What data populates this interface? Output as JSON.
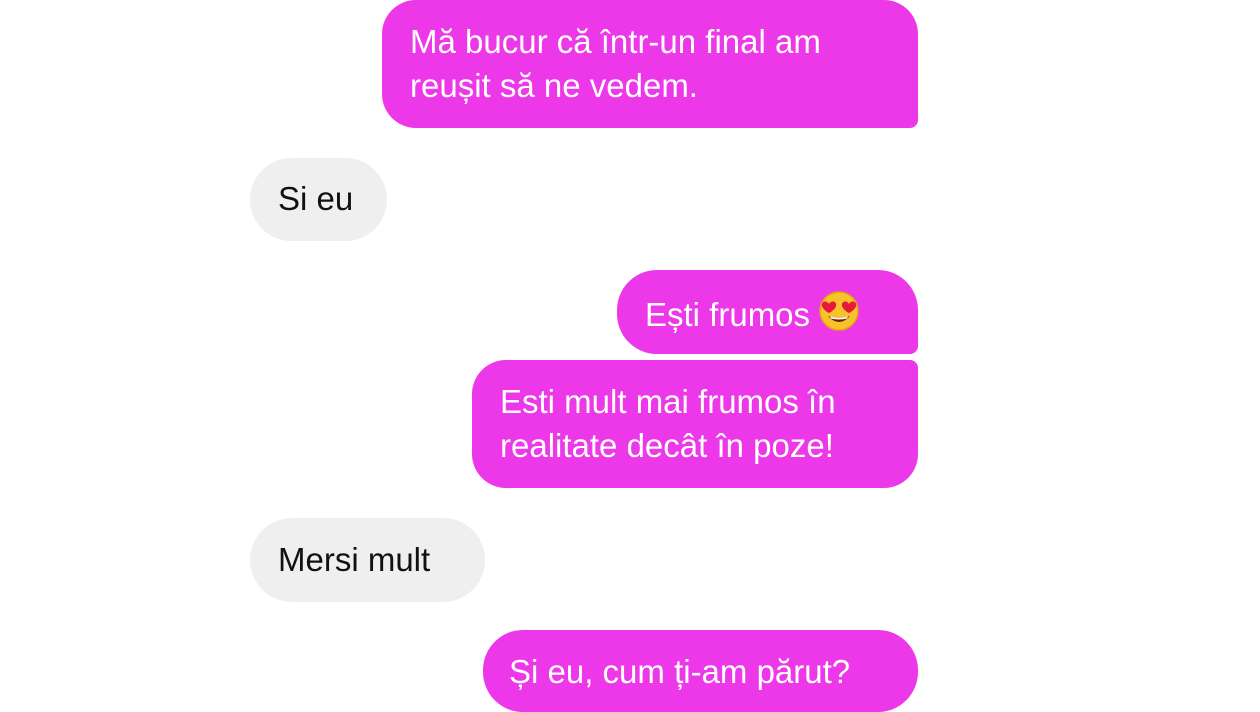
{
  "messages": [
    {
      "direction": "outgoing",
      "lines": [
        "Mă bucur că într-un final am",
        "reușit să ne vedem."
      ]
    },
    {
      "direction": "incoming",
      "lines": [
        "Si eu"
      ]
    },
    {
      "direction": "outgoing",
      "lines": [
        "Ești frumos"
      ],
      "emoji": "heart-eyes-emoji-icon"
    },
    {
      "direction": "outgoing",
      "lines": [
        "Esti mult mai frumos în",
        "realitate decât în poze!"
      ]
    },
    {
      "direction": "incoming",
      "lines": [
        "Mersi mult"
      ]
    },
    {
      "direction": "outgoing",
      "lines": [
        "Și eu, cum ți-am părut?"
      ]
    }
  ],
  "colors": {
    "outgoing_bubble": "#ec38e8",
    "outgoing_text": "#ffffff",
    "incoming_bubble": "#efefef",
    "incoming_text": "#111111",
    "background": "#ffffff"
  }
}
